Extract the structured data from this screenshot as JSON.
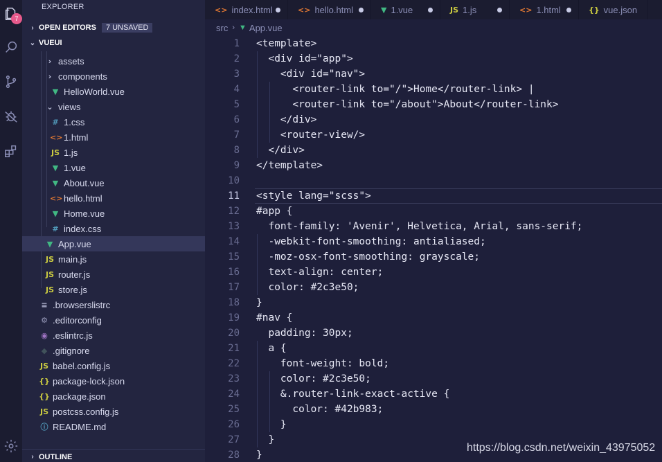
{
  "activity_bar": {
    "explorer_badge": "7"
  },
  "sidebar": {
    "title": "EXPLORER",
    "open_editors": {
      "label": "OPEN EDITORS",
      "badge": "7 UNSAVED"
    },
    "project": {
      "label": "VUEUI"
    },
    "outline": {
      "label": "OUTLINE"
    },
    "tree": [
      {
        "label": "assets",
        "icon": "›",
        "icon_color": "#c8cbe6",
        "indent": 1,
        "selected": false
      },
      {
        "label": "components",
        "icon": "›",
        "icon_color": "#c8cbe6",
        "indent": 1,
        "selected": false
      },
      {
        "label": "HelloWorld.vue",
        "icon": "▼",
        "icon_color": "#41b883",
        "indent": 2,
        "selected": false
      },
      {
        "label": "views",
        "icon": "⌄",
        "icon_color": "#c8cbe6",
        "indent": 1,
        "selected": false
      },
      {
        "label": "1.css",
        "icon": "#",
        "icon_color": "#519aba",
        "indent": 2,
        "selected": false
      },
      {
        "label": "1.html",
        "icon": "<>",
        "icon_color": "#e37933",
        "indent": 2,
        "selected": false
      },
      {
        "label": "1.js",
        "icon": "JS",
        "icon_color": "#cbcb41",
        "indent": 2,
        "selected": false
      },
      {
        "label": "1.vue",
        "icon": "▼",
        "icon_color": "#41b883",
        "indent": 2,
        "selected": false
      },
      {
        "label": "About.vue",
        "icon": "▼",
        "icon_color": "#41b883",
        "indent": 2,
        "selected": false
      },
      {
        "label": "hello.html",
        "icon": "<>",
        "icon_color": "#e37933",
        "indent": 2,
        "selected": false
      },
      {
        "label": "Home.vue",
        "icon": "▼",
        "icon_color": "#41b883",
        "indent": 2,
        "selected": false
      },
      {
        "label": "index.css",
        "icon": "#",
        "icon_color": "#519aba",
        "indent": 2,
        "selected": false
      },
      {
        "label": "App.vue",
        "icon": "▼",
        "icon_color": "#41b883",
        "indent": 1,
        "selected": true
      },
      {
        "label": "main.js",
        "icon": "JS",
        "icon_color": "#cbcb41",
        "indent": 1,
        "selected": false
      },
      {
        "label": "router.js",
        "icon": "JS",
        "icon_color": "#cbcb41",
        "indent": 1,
        "selected": false
      },
      {
        "label": "store.js",
        "icon": "JS",
        "icon_color": "#cbcb41",
        "indent": 1,
        "selected": false
      },
      {
        "label": ".browserslistrc",
        "icon": "≡",
        "icon_color": "#b6b8d4",
        "indent": 0,
        "selected": false
      },
      {
        "label": ".editorconfig",
        "icon": "⚙",
        "icon_color": "#9a9cbc",
        "indent": 0,
        "selected": false
      },
      {
        "label": ".eslintrc.js",
        "icon": "◉",
        "icon_color": "#a074c4",
        "indent": 0,
        "selected": false
      },
      {
        "label": ".gitignore",
        "icon": "◆",
        "icon_color": "#41535b",
        "indent": 0,
        "selected": false
      },
      {
        "label": "babel.config.js",
        "icon": "JS",
        "icon_color": "#cbcb41",
        "indent": 0,
        "selected": false
      },
      {
        "label": "package-lock.json",
        "icon": "{}",
        "icon_color": "#cbcb41",
        "indent": 0,
        "selected": false
      },
      {
        "label": "package.json",
        "icon": "{}",
        "icon_color": "#cbcb41",
        "indent": 0,
        "selected": false
      },
      {
        "label": "postcss.config.js",
        "icon": "JS",
        "icon_color": "#cbcb41",
        "indent": 0,
        "selected": false
      },
      {
        "label": "README.md",
        "icon": "ⓘ",
        "icon_color": "#519aba",
        "indent": 0,
        "selected": false
      }
    ]
  },
  "tabs": [
    {
      "label": "index.html",
      "icon": "<>",
      "icon_color": "#e37933"
    },
    {
      "label": "hello.html",
      "icon": "<>",
      "icon_color": "#e37933"
    },
    {
      "label": "1.vue",
      "icon": "▼",
      "icon_color": "#41b883"
    },
    {
      "label": "1.js",
      "icon": "JS",
      "icon_color": "#cbcb41"
    },
    {
      "label": "1.html",
      "icon": "<>",
      "icon_color": "#e37933"
    },
    {
      "label": "vue.json",
      "icon": "{}",
      "icon_color": "#cbcb41"
    }
  ],
  "breadcrumb": {
    "folder": "src",
    "separator": "›",
    "file": "App.vue"
  },
  "editor": {
    "current_line": 11,
    "lines": [
      {
        "n": "1",
        "text": "<template>"
      },
      {
        "n": "2",
        "text": "  <div id=\"app\">"
      },
      {
        "n": "3",
        "text": "    <div id=\"nav\">"
      },
      {
        "n": "4",
        "text": "      <router-link to=\"/\">Home</router-link> |"
      },
      {
        "n": "5",
        "text": "      <router-link to=\"/about\">About</router-link>"
      },
      {
        "n": "6",
        "text": "    </div>"
      },
      {
        "n": "7",
        "text": "    <router-view/>"
      },
      {
        "n": "8",
        "text": "  </div>"
      },
      {
        "n": "9",
        "text": "</template>"
      },
      {
        "n": "10",
        "text": ""
      },
      {
        "n": "11",
        "text": "<style lang=\"scss\">"
      },
      {
        "n": "12",
        "text": "#app {"
      },
      {
        "n": "13",
        "text": "  font-family: 'Avenir', Helvetica, Arial, sans-serif;"
      },
      {
        "n": "14",
        "text": "  -webkit-font-smoothing: antialiased;"
      },
      {
        "n": "15",
        "text": "  -moz-osx-font-smoothing: grayscale;"
      },
      {
        "n": "16",
        "text": "  text-align: center;"
      },
      {
        "n": "17",
        "text": "  color: #2c3e50;"
      },
      {
        "n": "18",
        "text": "}"
      },
      {
        "n": "19",
        "text": "#nav {"
      },
      {
        "n": "20",
        "text": "  padding: 30px;"
      },
      {
        "n": "21",
        "text": "  a {"
      },
      {
        "n": "22",
        "text": "    font-weight: bold;"
      },
      {
        "n": "23",
        "text": "    color: #2c3e50;"
      },
      {
        "n": "24",
        "text": "    &.router-link-exact-active {"
      },
      {
        "n": "25",
        "text": "      color: #42b983;"
      },
      {
        "n": "26",
        "text": "    }"
      },
      {
        "n": "27",
        "text": "  }"
      },
      {
        "n": "28",
        "text": "}"
      }
    ]
  },
  "watermark": "https://blog.csdn.net/weixin_43975052"
}
